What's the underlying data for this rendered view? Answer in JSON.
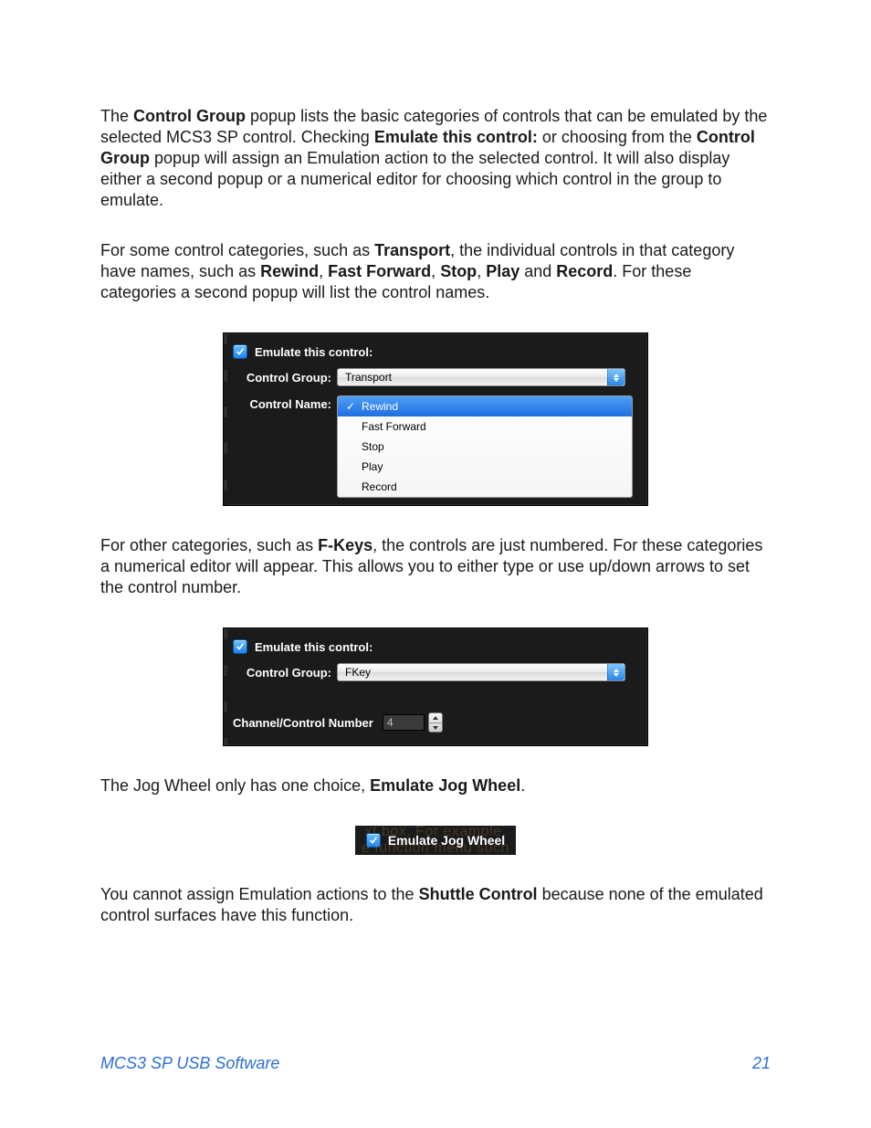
{
  "paragraphs": {
    "p1_a": "The ",
    "p1_b1": "Control Group",
    "p1_c": " popup lists the basic categories of controls that can be emulated by the selected MCS3 SP control. Checking ",
    "p1_b2": "Emulate this control:",
    "p1_d": " or choosing from the ",
    "p1_b3": "Control Group",
    "p1_e": " popup will assign an Emulation action to the selected control. It will also display either a second popup or a numerical editor for choosing which control in the group to emulate.",
    "p2_a": "For some control categories, such as ",
    "p2_b1": "Transport",
    "p2_c": ", the individual controls in that category have names, such as ",
    "p2_b2": "Rewind",
    "p2_d": ", ",
    "p2_b3": "Fast Forward",
    "p2_e": ", ",
    "p2_b4": "Stop",
    "p2_f": ", ",
    "p2_b5": "Play",
    "p2_g": " and ",
    "p2_b6": "Record",
    "p2_h": ". For these categories a second popup will list the control names.",
    "p3_a": "For other categories, such as ",
    "p3_b1": "F-Keys",
    "p3_c": ", the controls are just numbered. For these categories a numerical editor will appear. This allows you to either type or use up/down arrows to set the control number.",
    "p4_a": "The Jog Wheel only has one choice, ",
    "p4_b1": "Emulate Jog Wheel",
    "p4_c": ".",
    "p5_a": "You cannot assign Emulation actions to the ",
    "p5_b1": "Shuttle Control",
    "p5_c": " because none of the emulated control surfaces have this function."
  },
  "fig1": {
    "emulate_label": "Emulate this control:",
    "control_group_label": "Control Group:",
    "control_group_value": "Transport",
    "control_name_label": "Control Name:",
    "options": {
      "o0": "Rewind",
      "o1": "Fast Forward",
      "o2": "Stop",
      "o3": "Play",
      "o4": "Record"
    },
    "tick": "✓"
  },
  "fig2": {
    "emulate_label": "Emulate this control:",
    "control_group_label": "Control Group:",
    "control_group_value": "FKey",
    "channel_label": "Channel/Control Number",
    "channel_value": "4"
  },
  "fig3": {
    "label": "Emulate Jog Wheel",
    "ghost_top": "xt box. For example,",
    "ghost_bottom": "e function menu such"
  },
  "footer": {
    "title": "MCS3 SP USB Software",
    "page": "21"
  }
}
